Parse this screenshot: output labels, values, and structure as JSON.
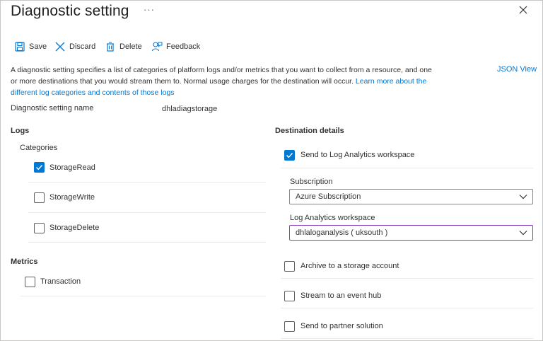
{
  "header": {
    "title": "Diagnostic setting",
    "more_label": "···"
  },
  "toolbar": {
    "save": "Save",
    "discard": "Discard",
    "delete": "Delete",
    "feedback": "Feedback"
  },
  "description": {
    "text": "A diagnostic setting specifies a list of categories of platform logs and/or metrics that you want to collect from a resource, and one or more destinations that you would stream them to. Normal usage charges for the destination will occur. ",
    "link": "Learn more about the different log categories and contents of those logs"
  },
  "json_view": "JSON View",
  "setting_name": {
    "label": "Diagnostic setting name",
    "value": "dhladiagstorage"
  },
  "logs": {
    "heading": "Logs",
    "categories_label": "Categories",
    "items": [
      {
        "label": "StorageRead",
        "checked": true
      },
      {
        "label": "StorageWrite",
        "checked": false
      },
      {
        "label": "StorageDelete",
        "checked": false
      }
    ]
  },
  "metrics": {
    "heading": "Metrics",
    "items": [
      {
        "label": "Transaction",
        "checked": false
      }
    ]
  },
  "destination": {
    "heading": "Destination details",
    "log_analytics": {
      "label": "Send to Log Analytics workspace",
      "checked": true
    },
    "subscription": {
      "label": "Subscription",
      "value": "Azure Subscription"
    },
    "workspace": {
      "label": "Log Analytics workspace",
      "value": "dhlaloganalysis ( uksouth )"
    },
    "archive": {
      "label": "Archive to a storage account",
      "checked": false
    },
    "event_hub": {
      "label": "Stream to an event hub",
      "checked": false
    },
    "partner": {
      "label": "Send to partner solution",
      "checked": false
    }
  },
  "colors": {
    "accent": "#0078d4",
    "focus_border": "#8a3fbf"
  }
}
